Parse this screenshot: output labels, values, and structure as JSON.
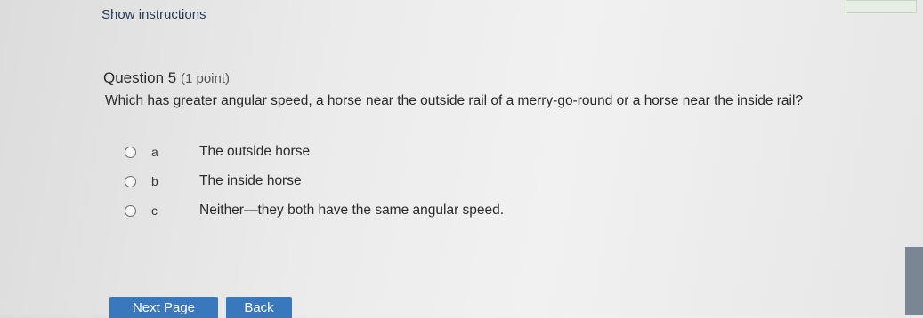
{
  "header": {
    "show_instructions": "Show instructions"
  },
  "question": {
    "number_label": "Question 5",
    "points": "(1 point)",
    "text": "Which has greater angular speed, a horse near the outside rail of a merry-go-round or a horse near the inside rail?",
    "options": [
      {
        "letter": "a",
        "text": "The outside horse",
        "selected": false
      },
      {
        "letter": "b",
        "text": "The inside horse",
        "selected": false
      },
      {
        "letter": "c",
        "text": "Neither—they both have the same angular speed.",
        "selected": false
      }
    ]
  },
  "footer": {
    "next_page_label": "Next Page",
    "back_label": "Back"
  },
  "colors": {
    "button": "#3a78bd",
    "link": "#2a3d55"
  }
}
